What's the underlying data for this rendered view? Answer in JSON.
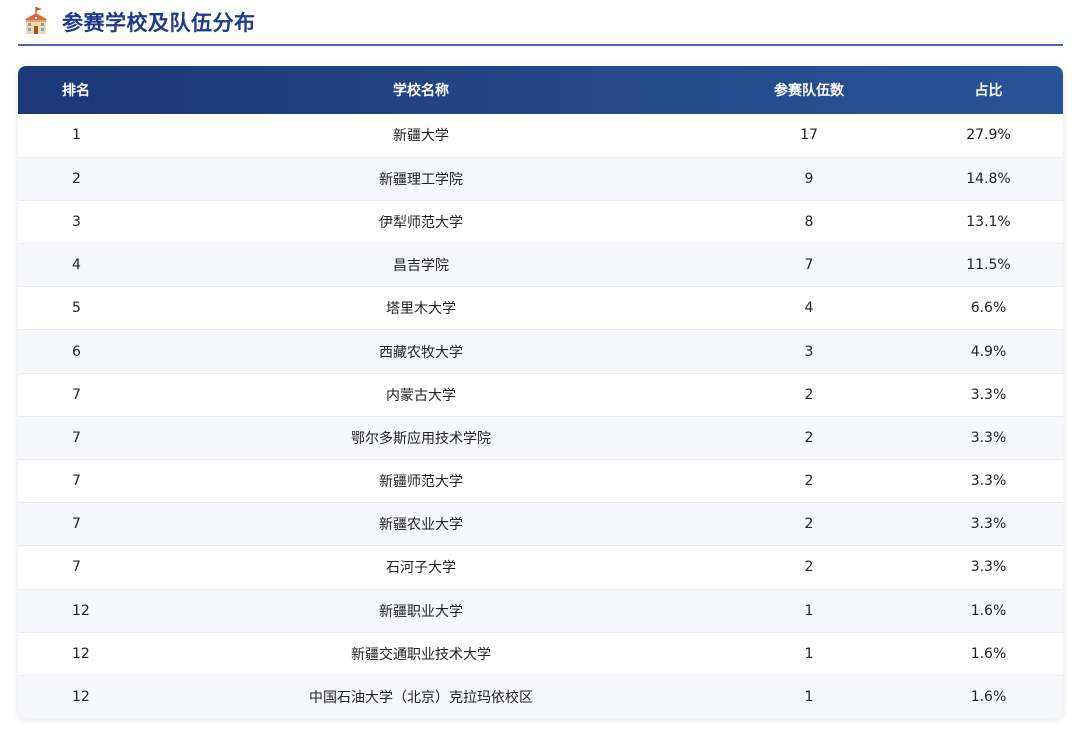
{
  "header": {
    "title": "参赛学校及队伍分布"
  },
  "table": {
    "columns": [
      "排名",
      "学校名称",
      "参赛队伍数",
      "占比"
    ],
    "rows": [
      {
        "rank": "1",
        "school": "新疆大学",
        "teams": "17",
        "share": "27.9%"
      },
      {
        "rank": "2",
        "school": "新疆理工学院",
        "teams": "9",
        "share": "14.8%"
      },
      {
        "rank": "3",
        "school": "伊犁师范大学",
        "teams": "8",
        "share": "13.1%"
      },
      {
        "rank": "4",
        "school": "昌吉学院",
        "teams": "7",
        "share": "11.5%"
      },
      {
        "rank": "5",
        "school": "塔里木大学",
        "teams": "4",
        "share": "6.6%"
      },
      {
        "rank": "6",
        "school": "西藏农牧大学",
        "teams": "3",
        "share": "4.9%"
      },
      {
        "rank": "7",
        "school": "内蒙古大学",
        "teams": "2",
        "share": "3.3%"
      },
      {
        "rank": "7",
        "school": "鄂尔多斯应用技术学院",
        "teams": "2",
        "share": "3.3%"
      },
      {
        "rank": "7",
        "school": "新疆师范大学",
        "teams": "2",
        "share": "3.3%"
      },
      {
        "rank": "7",
        "school": "新疆农业大学",
        "teams": "2",
        "share": "3.3%"
      },
      {
        "rank": "7",
        "school": "石河子大学",
        "teams": "2",
        "share": "3.3%"
      },
      {
        "rank": "12",
        "school": "新疆职业大学",
        "teams": "1",
        "share": "1.6%"
      },
      {
        "rank": "12",
        "school": "新疆交通职业技术大学",
        "teams": "1",
        "share": "1.6%"
      },
      {
        "rank": "12",
        "school": "中国石油大学（北京）克拉玛依校区",
        "teams": "1",
        "share": "1.6%"
      }
    ]
  },
  "colors": {
    "title": "#1f3a8a",
    "header_bg_start": "#1c3876",
    "header_bg_end": "#2a5499",
    "rule": "#4a63c2"
  },
  "icons": {
    "title_icon": "school-building-icon"
  }
}
